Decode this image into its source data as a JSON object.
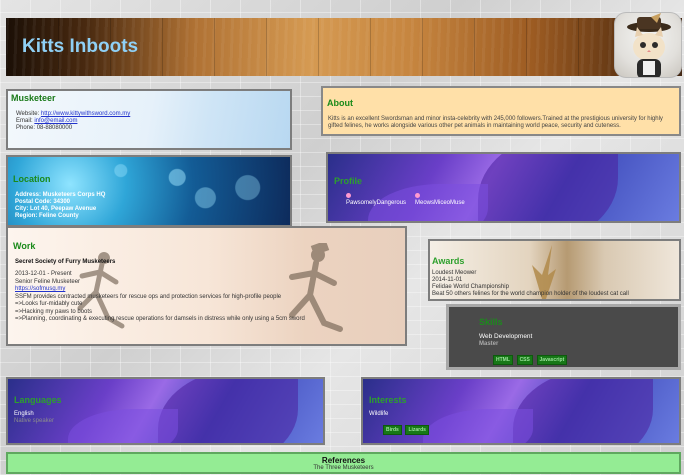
{
  "header": {
    "title": "Kitts Inboots"
  },
  "musketeer": {
    "heading": "Musketeer",
    "website_label": "Website:",
    "website": "http://www.kittywithsword.com.my",
    "email_label": "Email:",
    "email": "info@email.com",
    "phone_label": "Phone:",
    "phone": "08-88080000"
  },
  "about": {
    "heading": "About",
    "text": "Kitts is an excellent Swordsman and minor insta-celebrity with 245,000 followers.Trained at the prestigious university for highly gifted felines, he works alongside various other pet animals in maintaining world peace, security and cuteness."
  },
  "location": {
    "heading": "Location",
    "address": "Address: Musketeers Corps HQ",
    "postal": "Postal Code: 34300",
    "city": "City: Lot 40, Peepaw Avenue",
    "region": "Region: Feline County"
  },
  "profile": {
    "heading": "Profile",
    "items": [
      {
        "name": "PawsomelyDangerous"
      },
      {
        "name": "MeowsMiceoMuse"
      }
    ]
  },
  "work": {
    "heading": "Work",
    "company": "Secret Society of Furry Musketeers",
    "dates": "2013-12-01 - Present",
    "position": "Senior Feline Musketeer",
    "link": "https://sofmusg.my",
    "summary": "SSFM provides contracted musketeers for rescue ops and protection services for high-profile people",
    "highlights": [
      "=>Looks fur-midably cute",
      "=>Hacking my paws to boots",
      "=>Planning, coordinating & executing rescue operations for damsels in distress while only using a 5cm sword"
    ]
  },
  "awards": {
    "heading": "Awards",
    "title": "Loudest Meower",
    "date": "2014-11-01",
    "awarder": "Felidae World Championship",
    "summary": "Beat 50 others felines for the world champion holder of the loudest cat call"
  },
  "skills": {
    "heading": "Skills",
    "name": "Web Development",
    "level": "Master",
    "keywords": [
      "HTML",
      "CSS",
      "Javascript"
    ]
  },
  "languages": {
    "heading": "Languages",
    "language": "English",
    "fluency": "Native speaker"
  },
  "interests": {
    "heading": "Interests",
    "name": "Wildlife",
    "keywords": [
      "Birds",
      "Lizards"
    ]
  },
  "references": {
    "heading": "References",
    "name": "The Three Musketeers"
  },
  "colors": {
    "heading_green": "#1a8a1a",
    "title_blue": "#8fd0f5",
    "about_bg": "#ffe0a8",
    "references_bg": "#94ec94",
    "skills_bg": "#4a4a4a",
    "tag_bg": "#177817"
  }
}
